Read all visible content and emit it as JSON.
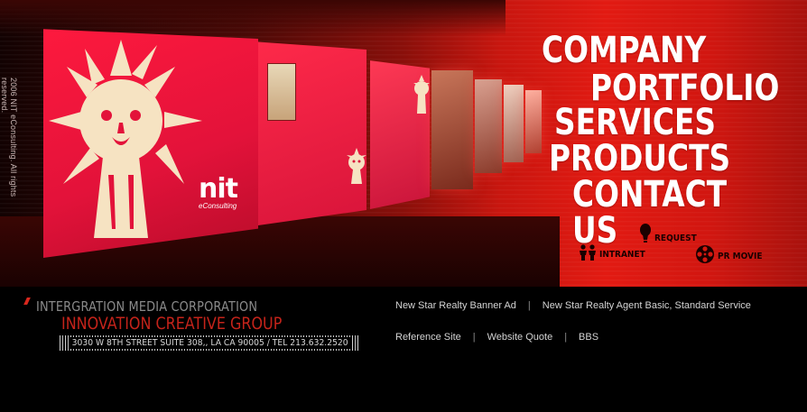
{
  "hero": {
    "copyright": "2006 NIT eConsulting. All rights reserved.",
    "brand": {
      "mark": "nit",
      "sub": "eConsulting"
    }
  },
  "nav": {
    "company": "COMPANY",
    "portfolio": "PORTFOLIO",
    "services": "SERVICES",
    "products": "PRODUCTS",
    "contact": "CONTACT US"
  },
  "quick_links": {
    "request": {
      "label": "REQUEST",
      "icon": "bulb-icon"
    },
    "intranet": {
      "label": "INTRANET",
      "icon": "people-icon"
    },
    "pr_movie": {
      "label": "PR MOVIE",
      "icon": "film-reel-icon"
    }
  },
  "footer": {
    "corp_name": "INTERGRATION MEDIA CORPORATION",
    "group_name": "INNOVATION CREATIVE GROUP",
    "address": "3030 W 8TH STREET SUITE 308,, LA CA 90005 / TEL 213.632.2520",
    "links_row1": [
      "New Star Realty Banner Ad",
      "New Star Realty Agent Basic, Standard Service"
    ],
    "links_row2": [
      "Reference Site",
      "Website Quote",
      "BBS"
    ],
    "separator": "|"
  },
  "colors": {
    "hero_red": "#e21a12",
    "group_red": "#c4231a",
    "footer_bg": "#000000",
    "link_text": "#d4d4d4"
  }
}
